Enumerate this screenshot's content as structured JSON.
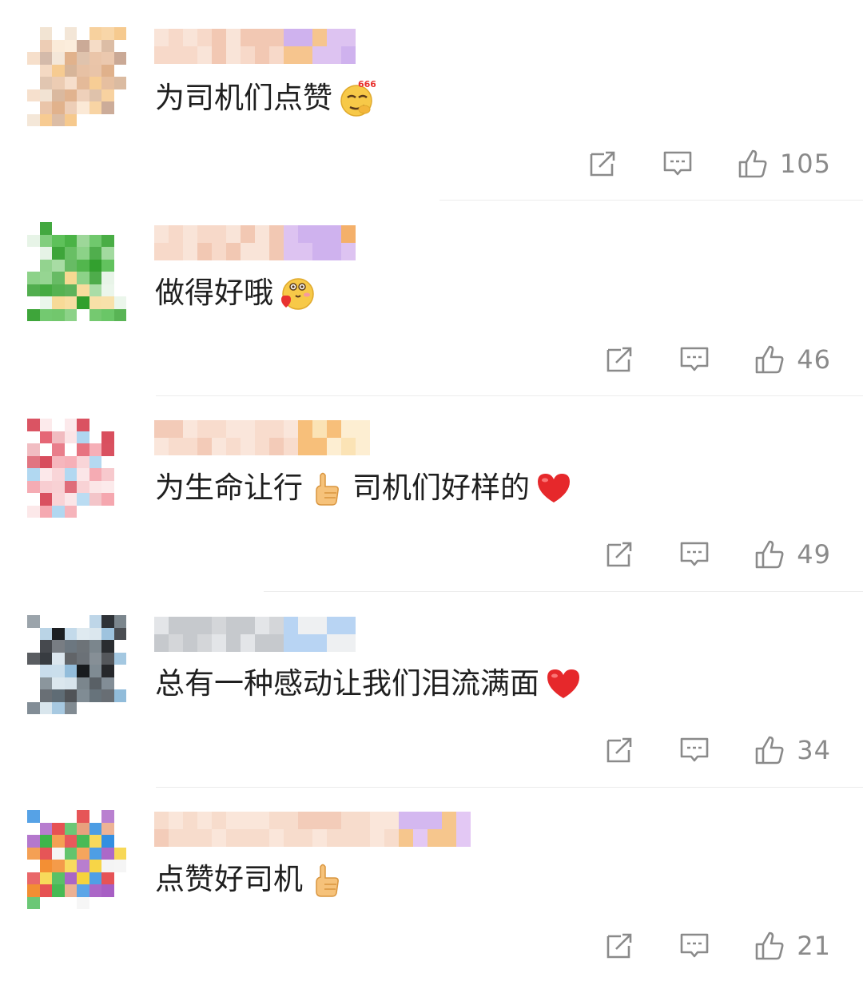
{
  "comments": [
    {
      "text": "为司机们点赞",
      "emoji": "smirk-666-emoji",
      "likes": "105",
      "avatar_palette": [
        "#f4d9c2",
        "#e9c3a6",
        "#c7a48f",
        "#f1e1cf",
        "#d7b498",
        "#f6c88b",
        "#fbe9d5",
        "#e0b08a"
      ]
    },
    {
      "text": "做得好哦",
      "emoji": "heart-hug-emoji",
      "likes": "46",
      "avatar_palette": [
        "#3fae3a",
        "#37a533",
        "#4cba48",
        "#69c464",
        "#2f9e2b",
        "#8fd28b",
        "#f6d78e",
        "#e6f3e5"
      ]
    },
    {
      "text": "为生命让行",
      "emoji": "thumbs-up-emoji",
      "text_after": "司机们好样的",
      "emoji_after": "red-heart-emoji",
      "likes": "49",
      "avatar_palette": [
        "#f7c9cd",
        "#e35a6a",
        "#f4a2ab",
        "#fbe3e5",
        "#d84b5b",
        "#aed6f0",
        "#ffffff",
        "#f0b7bd"
      ]
    },
    {
      "text": "总有一种感动让我们泪流满面",
      "emoji": "red-heart-emoji",
      "likes": "34",
      "avatar_palette": [
        "#2c3035",
        "#4b5259",
        "#7b8790",
        "#b9d3e6",
        "#8bb8d8",
        "#15181b",
        "#d7e4ec",
        "#5d6a73"
      ]
    },
    {
      "text": "点赞好司机",
      "emoji": "thumbs-up-emoji",
      "likes": "21",
      "avatar_palette": [
        "#2f8de0",
        "#3db64b",
        "#f6d23b",
        "#f28a2c",
        "#e2373a",
        "#a45ac2",
        "#f4f4f4",
        "#e8a07b"
      ]
    }
  ]
}
